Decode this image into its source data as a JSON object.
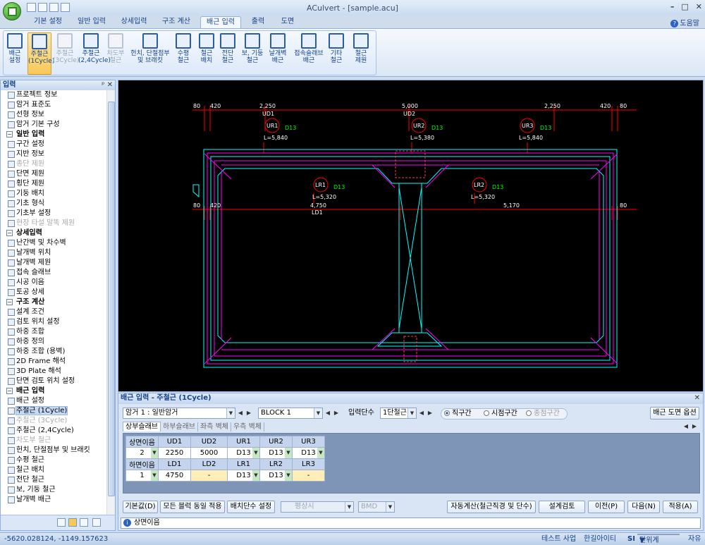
{
  "window": {
    "title": "ACulvert - [sample.acu]",
    "help_label": "도움말"
  },
  "ribbon_tabs": [
    "기본 설정",
    "일반 입력",
    "상세입력",
    "구조 계산",
    "배근 입력",
    "출력",
    "도면"
  ],
  "ribbon_buttons": [
    {
      "label": "배근\n설정",
      "enabled": true
    },
    {
      "label": "주철근\n(1Cycle)",
      "enabled": true,
      "selected": true
    },
    {
      "label": "주철근\n(3Cycle)",
      "enabled": false
    },
    {
      "label": "주철근\n(2,4Cycle)",
      "enabled": true
    },
    {
      "label": "차도부\n철근",
      "enabled": false
    },
    {
      "label": "헌치, 단절점부\n및 브래킷",
      "enabled": true
    },
    {
      "label": "수평\n철근",
      "enabled": true
    },
    {
      "label": "철근\n배치",
      "enabled": true
    },
    {
      "label": "전단\n철근",
      "enabled": true
    },
    {
      "label": "보, 기둥\n철근",
      "enabled": true
    },
    {
      "label": "날개벽\n배근",
      "enabled": true
    },
    {
      "label": "접속슬래브\n배근",
      "enabled": true
    },
    {
      "label": "기타\n철근",
      "enabled": true
    },
    {
      "label": "철근\n제원",
      "enabled": true
    }
  ],
  "left_panel": {
    "title": "입력",
    "tree": [
      {
        "label": "프로젝트 정보",
        "level": 1
      },
      {
        "label": "암거 표준도",
        "level": 1
      },
      {
        "label": "선형 정보",
        "level": 1
      },
      {
        "label": "암거 기본 구성",
        "level": 1
      },
      {
        "label": "일반 입력",
        "level": 0
      },
      {
        "label": "구간 설정",
        "level": 1
      },
      {
        "label": "지반 정보",
        "level": 1
      },
      {
        "label": "종단 제원",
        "level": 1,
        "disabled": true
      },
      {
        "label": "단면 제원",
        "level": 1
      },
      {
        "label": "횡단 제원",
        "level": 1
      },
      {
        "label": "기둥 배치",
        "level": 1
      },
      {
        "label": "기초 형식",
        "level": 1
      },
      {
        "label": "기초부 설정",
        "level": 1
      },
      {
        "label": "현장 타설 말뚝 제원",
        "level": 1,
        "disabled": true
      },
      {
        "label": "상세입력",
        "level": 0
      },
      {
        "label": "난간벽 및 차수벽",
        "level": 1
      },
      {
        "label": "날개벽 위치",
        "level": 1
      },
      {
        "label": "날개벽 제원",
        "level": 1
      },
      {
        "label": "접속 슬래브",
        "level": 1
      },
      {
        "label": "시공 이음",
        "level": 1
      },
      {
        "label": "토공 상세",
        "level": 1
      },
      {
        "label": "구조 계산",
        "level": 0
      },
      {
        "label": "설계 조건",
        "level": 1
      },
      {
        "label": "검토 위치 설정",
        "level": 1
      },
      {
        "label": "하중 조합",
        "level": 1
      },
      {
        "label": "하중 정의",
        "level": 1
      },
      {
        "label": "하중 조합 (용벽)",
        "level": 1
      },
      {
        "label": "2D Frame 해석",
        "level": 1
      },
      {
        "label": "3D Plate 해석",
        "level": 1
      },
      {
        "label": "단면 검토 위치 설정",
        "level": 1
      },
      {
        "label": "배근 입력",
        "level": 0
      },
      {
        "label": "배근 설정",
        "level": 1
      },
      {
        "label": "주철근 (1Cycle)",
        "level": 1,
        "selected": true
      },
      {
        "label": "주철근 (3Cycle)",
        "level": 1,
        "disabled": true
      },
      {
        "label": "주철근 (2,4Cycle)",
        "level": 1
      },
      {
        "label": "차도부 철근",
        "level": 1,
        "disabled": true
      },
      {
        "label": "헌치, 단절점부 및 브래킷",
        "level": 1
      },
      {
        "label": "수평 철근",
        "level": 1
      },
      {
        "label": "철근 배치",
        "level": 1
      },
      {
        "label": "전단 철근",
        "level": 1
      },
      {
        "label": "보, 기둥 철근",
        "level": 1
      },
      {
        "label": "날개벽 배근",
        "level": 1
      }
    ]
  },
  "drawing": {
    "dims_top": [
      "80",
      "420",
      "2,250",
      "5,000",
      "2,250",
      "420",
      "80"
    ],
    "dims_top_labels": [
      "UD1",
      "UD2"
    ],
    "dims_mid": [
      "80",
      "420",
      "4,750",
      "5,170",
      "80"
    ],
    "dims_mid_label": "LD1",
    "bars": [
      {
        "name": "UR1",
        "dia": "D13",
        "len": "L=5,840"
      },
      {
        "name": "UR2",
        "dia": "D13",
        "len": "L=5,380"
      },
      {
        "name": "UR3",
        "dia": "D13",
        "len": "L=5,840"
      },
      {
        "name": "LR1",
        "dia": "D13",
        "len": "L=5,320"
      },
      {
        "name": "LR2",
        "dia": "D13",
        "len": "L=5,320"
      }
    ]
  },
  "input_panel": {
    "title": "배근 입력 - 주철근 (1Cycle)",
    "culvert_select": "암거 1 : 일반암거",
    "block_select": "BLOCK  1",
    "stage_label": "입력단수",
    "stage_select": "1단철근",
    "radios": [
      {
        "label": "직구간",
        "checked": true,
        "enabled": true
      },
      {
        "label": "시점구간",
        "checked": false,
        "enabled": true
      },
      {
        "label": "종점구간",
        "checked": false,
        "enabled": false
      }
    ],
    "drawing_option_button": "배근 도면 옵션",
    "subtabs": [
      "상부슬래브",
      "하부슬래브",
      "좌측 벽체",
      "우측 벽체"
    ],
    "table": {
      "upper_header": [
        "상면이음",
        "UD1",
        "UD2",
        "UR1",
        "UR2",
        "UR3"
      ],
      "upper_row": [
        "2",
        "2250",
        "5000",
        "D13",
        "D13",
        "D13"
      ],
      "lower_header": [
        "하면이음",
        "LD1",
        "LD2",
        "LR1",
        "LR2",
        "LR3"
      ],
      "lower_row": [
        "1",
        "4750",
        "-",
        "D13",
        "D13",
        "-"
      ]
    },
    "buttons": {
      "default": "기본값(D)",
      "apply_all": "모든 블럭 동일 적용",
      "stage_set": "배치단수 설정",
      "combo1": "평상시",
      "combo2": "BMD",
      "auto_calc": "자동계산(철근직경 및 단수)",
      "design_check": "설계검토",
      "prev": "이전(P)",
      "next": "다음(N)",
      "apply": "적용(A)"
    },
    "status_text": "상면이음"
  },
  "status_bar": {
    "coords": "-5620.028124,  -1149.157623",
    "items": [
      "테스트 사업",
      "한길아이티"
    ],
    "unit_label": "SI",
    "unit_system": "단위계",
    "mode": "자유"
  },
  "colors": {
    "accent": "#15428b",
    "canvas_bg": "#000000",
    "concrete": "#00ffff",
    "rebar": "#ff00ff",
    "dim": "#ff0000",
    "text": "#00ff00"
  }
}
